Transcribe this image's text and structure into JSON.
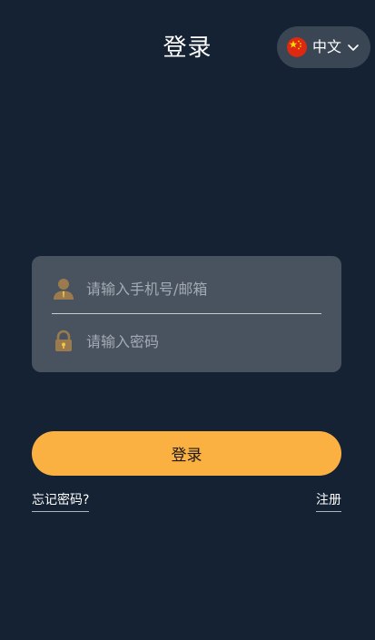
{
  "header": {
    "title": "登录"
  },
  "language": {
    "label": "中文",
    "flag_icon": "china-flag-icon",
    "chevron_icon": "chevron-down-icon"
  },
  "form": {
    "account": {
      "placeholder": "请输入手机号/邮箱",
      "value": "",
      "icon": "user-icon"
    },
    "password": {
      "placeholder": "请输入密码",
      "value": "",
      "icon": "lock-icon"
    }
  },
  "actions": {
    "login_label": "登录",
    "forgot_label": "忘记密码?",
    "register_label": "注册"
  },
  "colors": {
    "background": "#142233",
    "card": "#48535f",
    "accent": "#fbb042",
    "icon": "#9b7b4e"
  }
}
